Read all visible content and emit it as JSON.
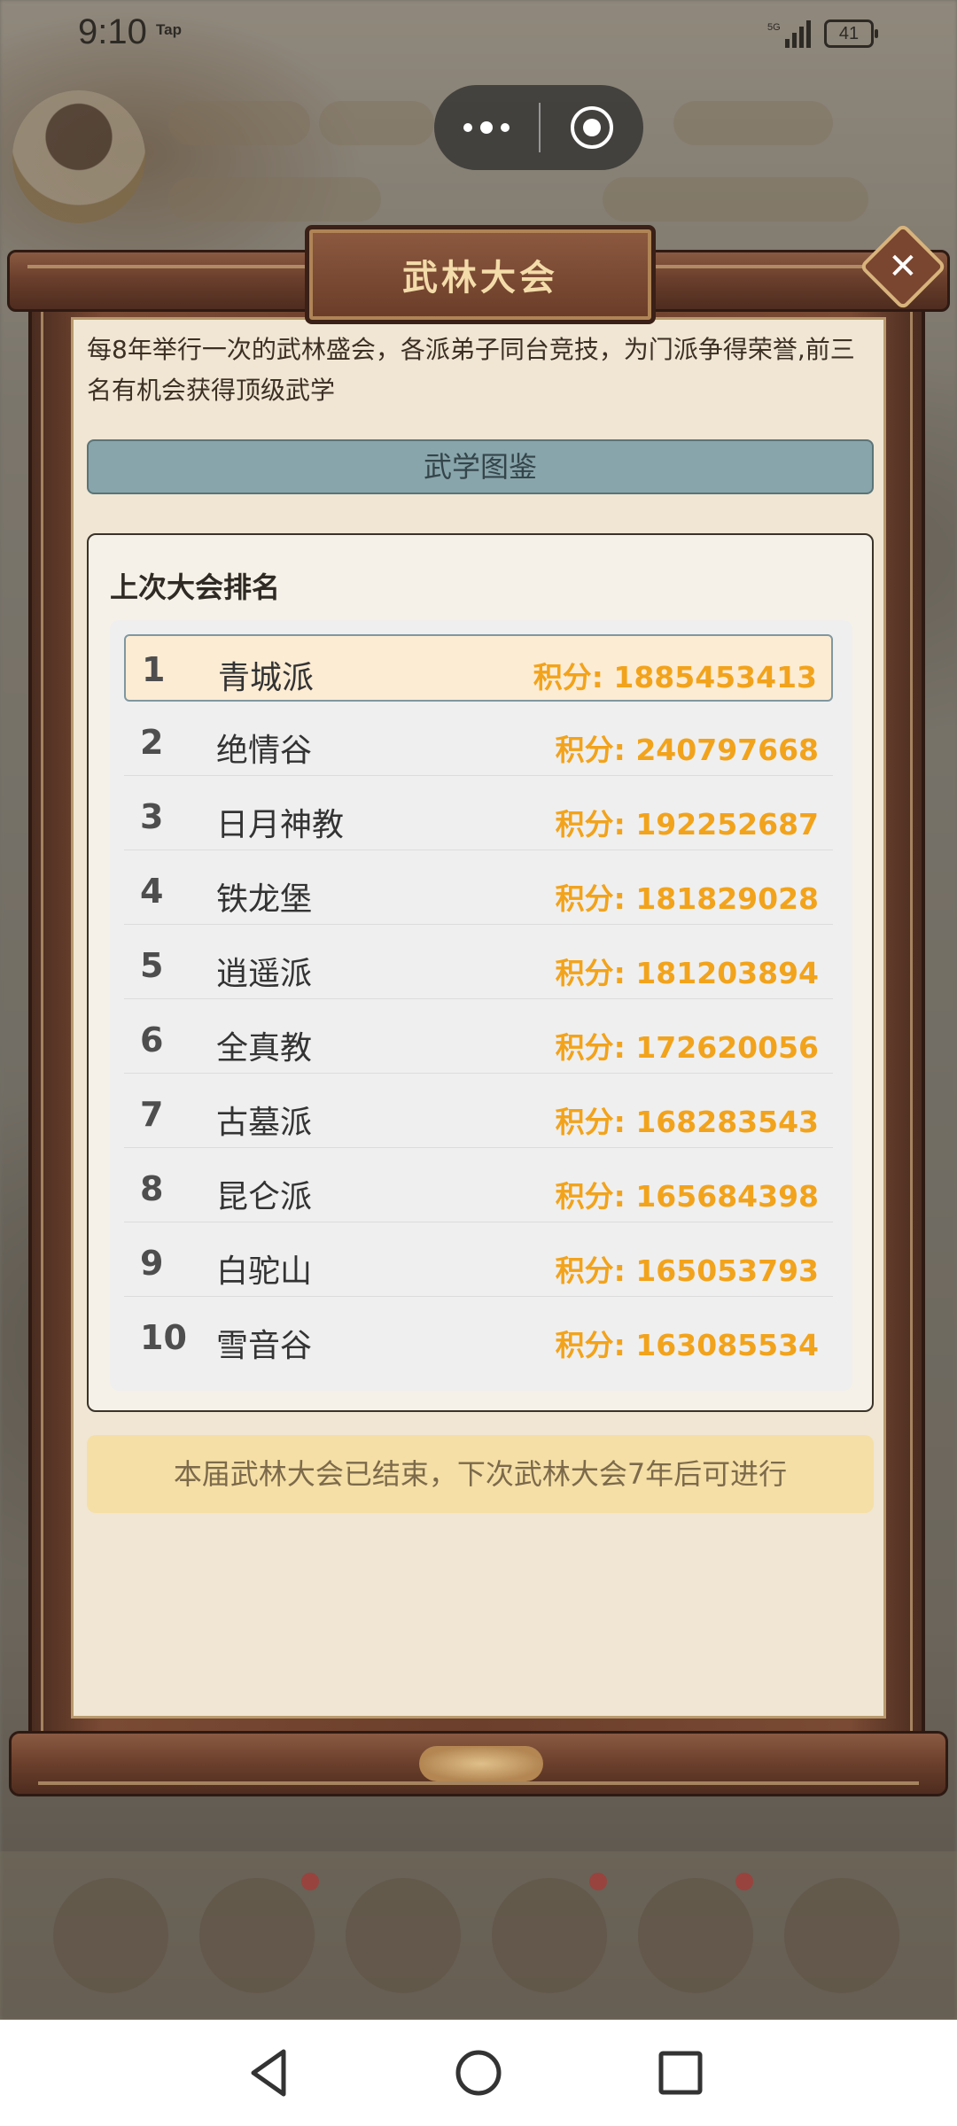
{
  "status_bar": {
    "time": "9:10",
    "tap_label": "Tap",
    "battery": "41"
  },
  "modal": {
    "title": "武林大会",
    "close_symbol": "✕",
    "intro": "每8年举行一次的武林盛会，各派弟子同台竞技，为门派争得荣誉,前三名有机会获得顶级武学",
    "tujian_button": "武学图鉴",
    "ranking": {
      "title": "上次大会排名",
      "score_prefix": "积分: ",
      "rows": [
        {
          "rank": "1",
          "name": "青城派",
          "score": "积分: 1885453413"
        },
        {
          "rank": "2",
          "name": "绝情谷",
          "score": "积分: 240797668"
        },
        {
          "rank": "3",
          "name": "日月神教",
          "score": "积分: 192252687"
        },
        {
          "rank": "4",
          "name": "铁龙堡",
          "score": "积分: 181829028"
        },
        {
          "rank": "5",
          "name": "逍遥派",
          "score": "积分: 181203894"
        },
        {
          "rank": "6",
          "name": "全真教",
          "score": "积分: 172620056"
        },
        {
          "rank": "7",
          "name": "古墓派",
          "score": "积分: 168283543"
        },
        {
          "rank": "8",
          "name": "昆仑派",
          "score": "积分: 165684398"
        },
        {
          "rank": "9",
          "name": "白驼山",
          "score": "积分: 165053793"
        },
        {
          "rank": "10",
          "name": "雪音谷",
          "score": "积分: 163085534"
        }
      ]
    },
    "notice": "本届武林大会已结束，下次武林大会7年后可进行"
  },
  "system_nav": {
    "icons": [
      "back-icon",
      "home-icon",
      "recents-icon"
    ]
  },
  "colors": {
    "frame_wood": "#6b3f2c",
    "paper": "#f0e6d3",
    "score_orange": "#f2a31c",
    "tujian_button": "#88a5ab",
    "notice_bg": "#f5dfa6",
    "highlight_row": "#fdecd4"
  }
}
